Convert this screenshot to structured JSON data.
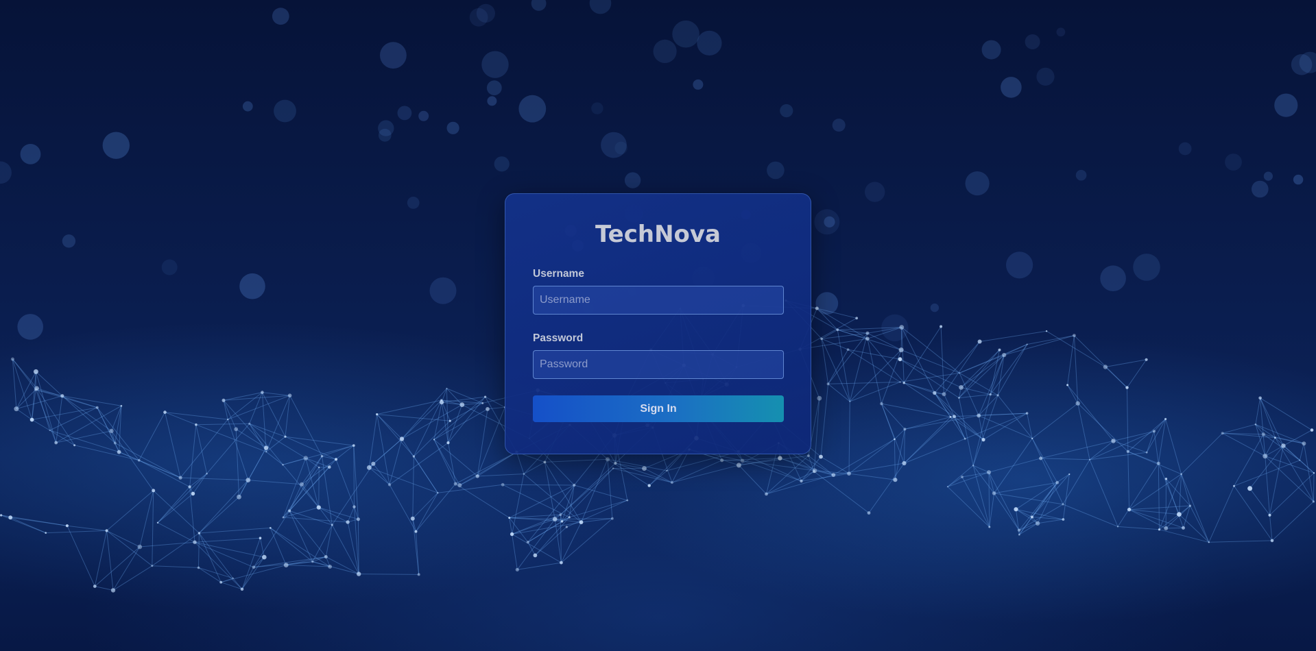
{
  "brand": {
    "name": "TechNova"
  },
  "login_form": {
    "username": {
      "label": "Username",
      "placeholder": "Username",
      "value": ""
    },
    "password": {
      "label": "Password",
      "placeholder": "Password",
      "value": ""
    },
    "submit_label": "Sign In"
  },
  "colors": {
    "background": "#061338",
    "card": "#14328c",
    "button_start": "#1550c8",
    "button_end": "#1590b0",
    "text": "#c6cad6"
  }
}
